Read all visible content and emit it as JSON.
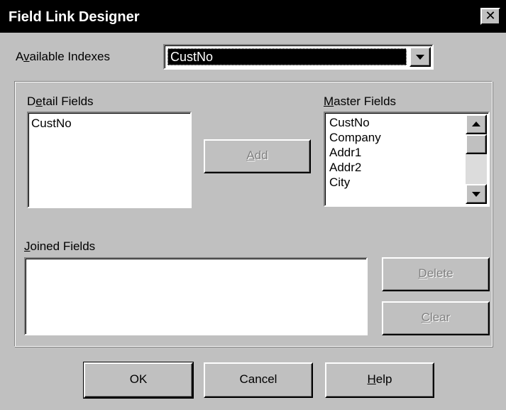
{
  "window": {
    "title": "Field Link Designer",
    "close_glyph": "✕"
  },
  "available_indexes": {
    "label_pre": "A",
    "label_u": "v",
    "label_post": "ailable Indexes",
    "selected": "CustNo"
  },
  "detail_fields": {
    "label_pre": "D",
    "label_u": "e",
    "label_post": "tail Fields",
    "items": [
      "CustNo"
    ]
  },
  "add_button": {
    "label_u": "A",
    "label_post": "dd"
  },
  "master_fields": {
    "label_u": "M",
    "label_post": "aster Fields",
    "items": [
      "CustNo",
      "Company",
      "Addr1",
      "Addr2",
      "City"
    ]
  },
  "joined_fields": {
    "label_u": "J",
    "label_post": "oined Fields"
  },
  "delete_button": {
    "label_u": "D",
    "label_post": "elete"
  },
  "clear_button": {
    "label_u": "C",
    "label_post": "lear"
  },
  "footer": {
    "ok_label": "OK",
    "cancel_label": "Cancel",
    "help_label_u": "H",
    "help_label_post": "elp"
  },
  "colors": {
    "face": "#c0c0c0",
    "titlebar": "#000000",
    "selection": "#000000",
    "disabled_text": "#808080"
  }
}
